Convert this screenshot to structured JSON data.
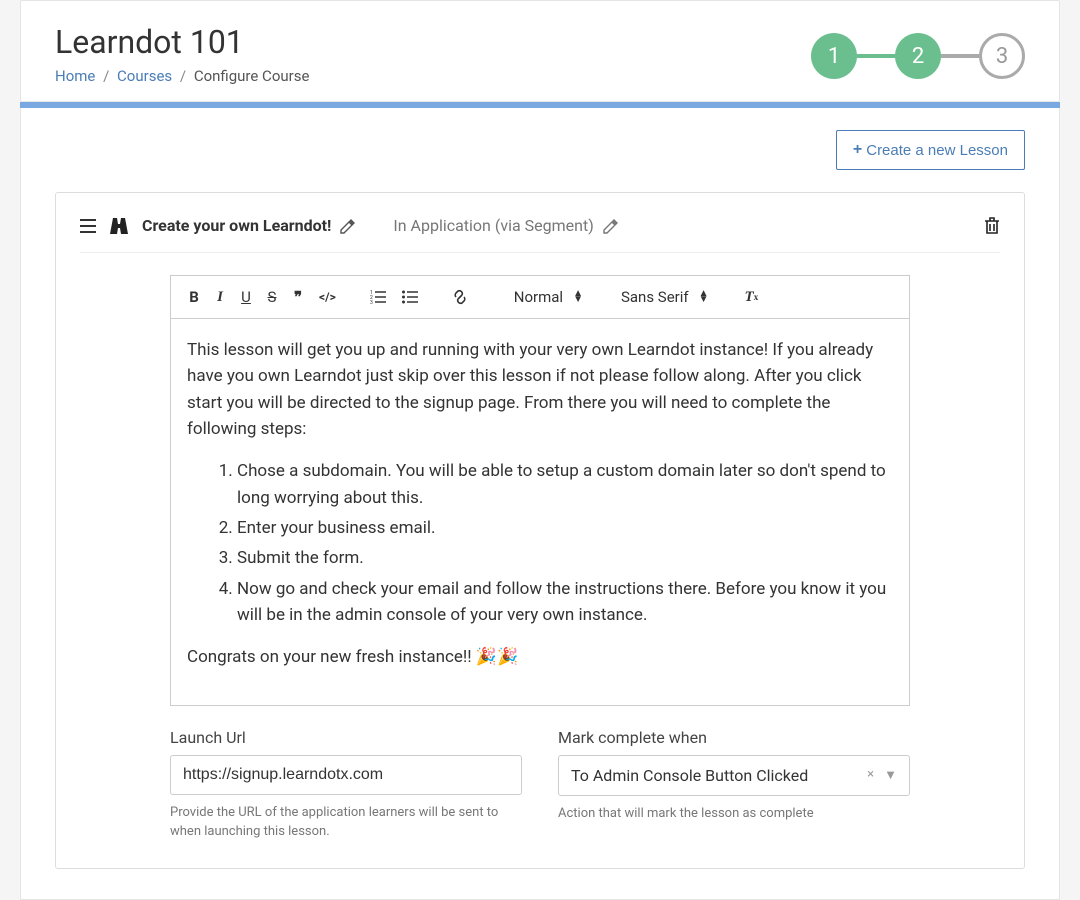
{
  "header": {
    "title": "Learndot 101",
    "breadcrumb": {
      "home": "Home",
      "courses": "Courses",
      "current": "Configure Course"
    }
  },
  "stepper": {
    "steps": [
      "1",
      "2",
      "3"
    ],
    "active_index": 1
  },
  "actions": {
    "create_lesson": "Create a new Lesson"
  },
  "lesson": {
    "title": "Create your own Learndot!",
    "type": "In Application (via Segment)"
  },
  "toolbar": {
    "bold": "B",
    "italic": "I",
    "underline": "U",
    "strike": "S",
    "quote": "❞",
    "code": "</>",
    "ol_icon": "≡",
    "ul_icon": "≡",
    "link_icon": "link",
    "normal": "Normal",
    "font": "Sans Serif",
    "clear": "Tx"
  },
  "editor": {
    "intro": "This lesson will get you up and running with your very own Learndot instance! If you already have you own Learndot just skip over this lesson if not please follow along. After you click start you will be directed to the signup page. From there you will need to complete the following steps:",
    "steps": [
      "Chose a subdomain. You will be able to setup a custom domain later so don't spend to long worrying about this.",
      "Enter your business email.",
      "Submit the form.",
      "Now go and check your email and follow the instructions there. Before you know it you will be in the admin console of your very own instance."
    ],
    "congrats": "Congrats on your new fresh instance!! 🎉🎉"
  },
  "form": {
    "launch_url": {
      "label": "Launch Url",
      "value": "https://signup.learndotx.com",
      "hint": "Provide the URL of the application learners will be sent to when launching this lesson."
    },
    "mark_complete": {
      "label": "Mark complete when",
      "value": "To Admin Console Button Clicked",
      "hint": "Action that will mark the lesson as complete"
    }
  }
}
